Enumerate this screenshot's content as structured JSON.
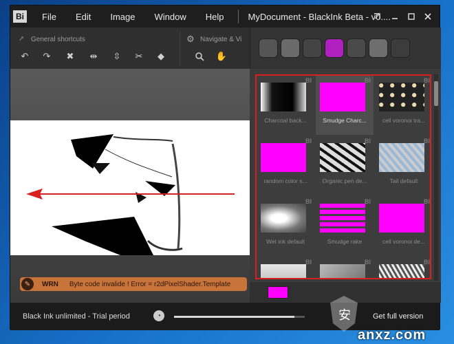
{
  "app": {
    "logo": "Bi",
    "menu": [
      "File",
      "Edit",
      "Image",
      "Window",
      "Help"
    ],
    "document_title": "MyDocument - BlackInk Beta - v0...."
  },
  "toolbar": {
    "group1_label": "General shortcuts",
    "group2_label": "Navigate & Vi",
    "icons": [
      "undo-icon",
      "redo-icon",
      "clear-icon",
      "flip-horizontal-icon",
      "flip-vertical-icon",
      "scissors-icon",
      "fill-icon",
      "zoom-icon",
      "pan-hand-icon"
    ]
  },
  "brush_strip": {
    "thumbs": [
      {
        "name": "brush-thumb-brush",
        "color": "#555555"
      },
      {
        "name": "brush-thumb-leaf",
        "color": "#6a6a6a"
      },
      {
        "name": "brush-thumb-dark-strokes",
        "color": "#444444"
      },
      {
        "name": "brush-thumb-magenta",
        "color": "#b020c0"
      },
      {
        "name": "brush-thumb-hatch",
        "color": "#4a4a4a"
      },
      {
        "name": "brush-thumb-curve",
        "color": "#6e6e6e"
      },
      {
        "name": "brush-thumb-eraser",
        "color": "#3c3c3c"
      }
    ]
  },
  "warning": {
    "code": "WRN",
    "message": "Byte code invalide ! Error = r2dPixelShader.Template"
  },
  "brushes": [
    {
      "label": "Charcoal back...",
      "thumb": "charcoal",
      "selected": false
    },
    {
      "label": "Smudge Charc...",
      "thumb": "magenta",
      "selected": true
    },
    {
      "label": "cell voronoi tra...",
      "thumb": "voronoi",
      "selected": false
    },
    {
      "label": "random color s...",
      "thumb": "magenta",
      "selected": false
    },
    {
      "label": "Organic pen de...",
      "thumb": "organic",
      "selected": false
    },
    {
      "label": "Tail default",
      "thumb": "tail",
      "selected": false
    },
    {
      "label": "Wet ink default",
      "thumb": "wetink",
      "selected": false
    },
    {
      "label": "Smudge rake",
      "thumb": "rake",
      "selected": false
    },
    {
      "label": "cell voronoi de...",
      "thumb": "magenta",
      "selected": false
    },
    {
      "label": "",
      "thumb": "light",
      "selected": false
    },
    {
      "label": "",
      "thumb": "grey",
      "selected": false
    },
    {
      "label": "",
      "thumb": "streaks",
      "selected": false
    }
  ],
  "brush_badge": "BI",
  "status": {
    "text": "Black Ink unlimited - Trial period",
    "progress": 0.92,
    "cta": "Get full version"
  },
  "colors": {
    "magenta": "#ff00ff",
    "annotation_red": "#d81e1e",
    "warning_bg": "#c8733a"
  },
  "watermark": "anxz.com"
}
